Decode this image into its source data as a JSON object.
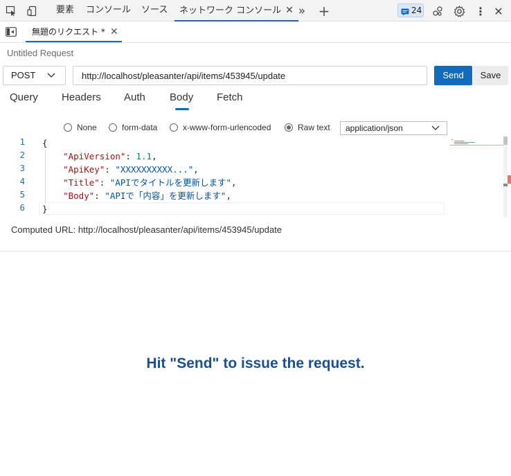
{
  "devtools_tabs": [
    {
      "label": "要素"
    },
    {
      "label": "コンソール"
    },
    {
      "label": "ソース"
    },
    {
      "label": "ネットワーク コンソール",
      "active": true
    }
  ],
  "issues_count": "24",
  "request_tab": {
    "label": "無題のリクエスト *"
  },
  "request_title": "Untitled Request",
  "method": "POST",
  "url": "http://localhost/pleasanter/api/items/453945/update",
  "send_label": "Send",
  "save_label": "Save",
  "sub_tabs": [
    "Query",
    "Headers",
    "Auth",
    "Body",
    "Fetch"
  ],
  "active_sub_tab": "Body",
  "body_modes": [
    "None",
    "form-data",
    "x-www-form-urlencoded",
    "Raw text"
  ],
  "selected_body_mode": "Raw text",
  "content_type": "application/json",
  "editor": {
    "line_numbers": [
      "1",
      "2",
      "3",
      "4",
      "5",
      "6"
    ],
    "lines": [
      {
        "tokens": [
          {
            "t": "{",
            "c": "p"
          }
        ]
      },
      {
        "tokens": [
          {
            "t": "    \"ApiVersion\"",
            "c": "k"
          },
          {
            "t": ": ",
            "c": "p"
          },
          {
            "t": "1.1",
            "c": "n"
          },
          {
            "t": ",",
            "c": "p"
          }
        ]
      },
      {
        "tokens": [
          {
            "t": "    \"ApiKey\"",
            "c": "k"
          },
          {
            "t": ": ",
            "c": "p"
          },
          {
            "t": "\"XXXXXXXXXX...\"",
            "c": "s"
          },
          {
            "t": ",",
            "c": "p"
          }
        ]
      },
      {
        "tokens": [
          {
            "t": "    \"Title\"",
            "c": "k"
          },
          {
            "t": ": ",
            "c": "p"
          },
          {
            "t": "\"APIでタイトルを更新します\"",
            "c": "s"
          },
          {
            "t": ",",
            "c": "p"
          }
        ]
      },
      {
        "tokens": [
          {
            "t": "    \"Body\"",
            "c": "k"
          },
          {
            "t": ": ",
            "c": "p"
          },
          {
            "t": "\"APIで「内容」を更新します\"",
            "c": "s"
          },
          {
            "t": ",",
            "c": "p"
          }
        ]
      },
      {
        "tokens": [
          {
            "t": "}",
            "c": "p"
          }
        ]
      }
    ]
  },
  "computed_url_label": "Computed URL: http://localhost/pleasanter/api/items/453945/update",
  "hint": "Hit \"Send\" to issue the request.",
  "colors": {
    "accent": "#0f6cbd",
    "hint": "#1d4f8f"
  }
}
